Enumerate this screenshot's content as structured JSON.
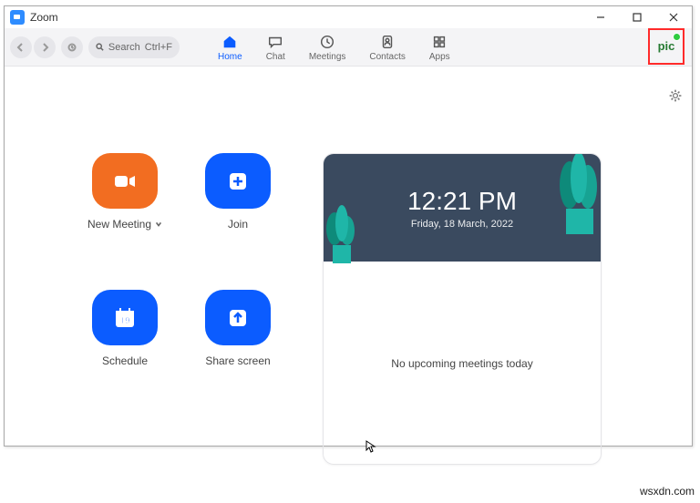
{
  "window": {
    "title": "Zoom"
  },
  "search": {
    "label": "Search",
    "shortcut": "Ctrl+F"
  },
  "tabs": {
    "home": "Home",
    "chat": "Chat",
    "meetings": "Meetings",
    "contacts": "Contacts",
    "apps": "Apps"
  },
  "avatar": {
    "initials": "pic"
  },
  "actions": {
    "new_meeting": "New Meeting",
    "join": "Join",
    "schedule": "Schedule",
    "share_screen": "Share screen",
    "schedule_day": "19"
  },
  "clock": {
    "time": "12:21 PM",
    "date": "Friday, 18 March, 2022"
  },
  "card": {
    "empty_msg": "No upcoming meetings today"
  },
  "watermark": "wsxdn.com"
}
